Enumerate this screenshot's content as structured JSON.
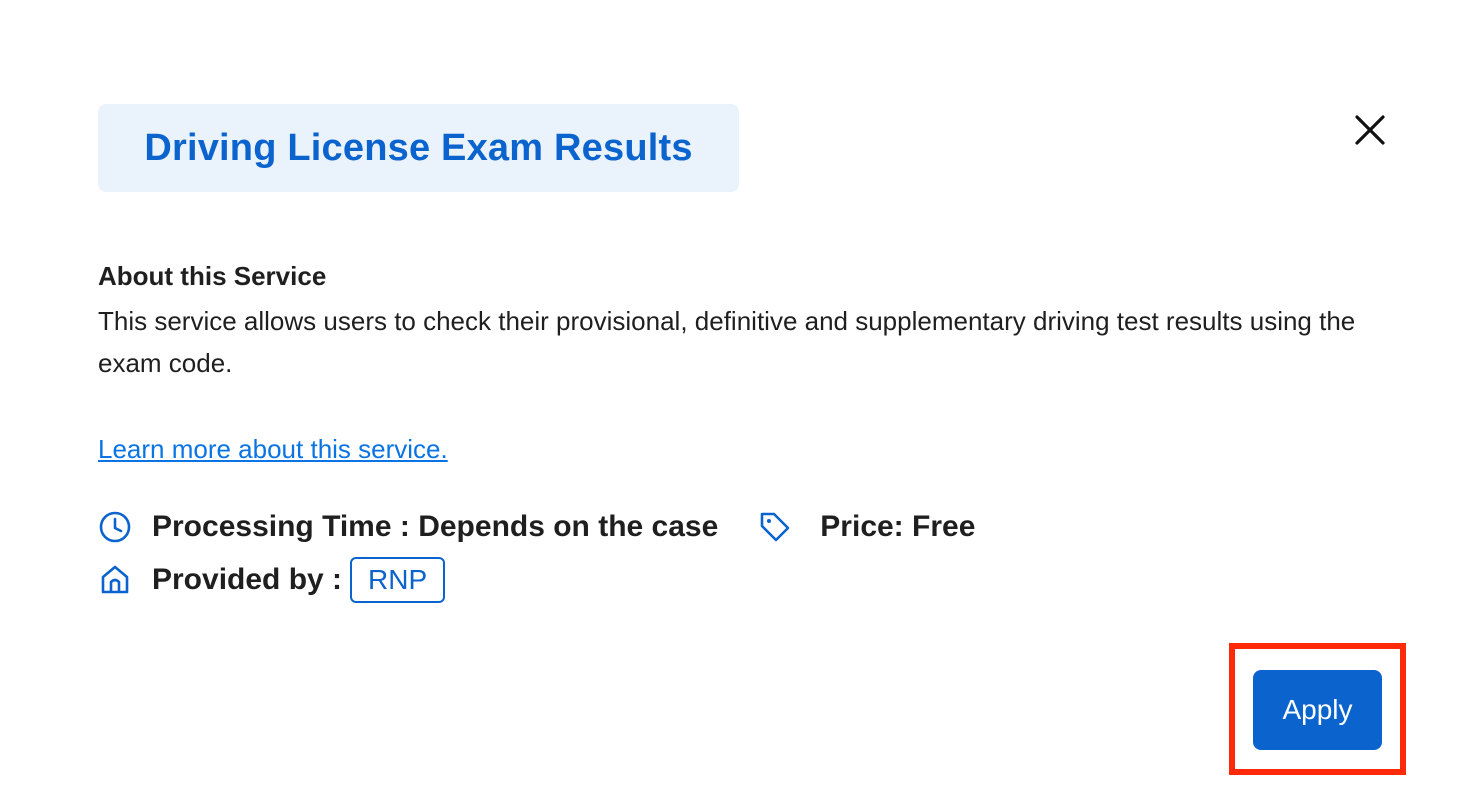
{
  "modal": {
    "title": "Driving License Exam Results",
    "close_icon": "close-icon"
  },
  "about": {
    "heading": "About this Service",
    "description": "This service allows users to check their provisional, definitive and supplementary driving test results using the exam code.",
    "learn_more_link": "Learn more about this service."
  },
  "meta": {
    "processing_time": "Processing Time : Depends on the case",
    "processing_icon": "clock-icon",
    "price": "Price: Free",
    "price_icon": "tag-icon",
    "provided_by_label": "Provided by :",
    "provided_by_icon": "home-icon",
    "provider": "RNP"
  },
  "actions": {
    "apply_label": "Apply"
  },
  "colors": {
    "accent": "#0b63ce",
    "link": "#0b74e5",
    "title_bg": "#eaf2fc",
    "highlight": "#ff2a0a"
  }
}
